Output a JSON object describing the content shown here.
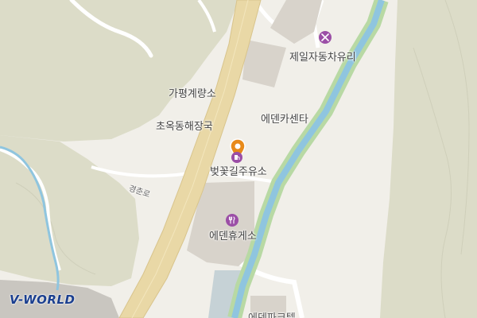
{
  "map": {
    "labels": {
      "weigh_station": "가평계량소",
      "restaurant": "초옥동해장국",
      "car_center": "에덴카센타",
      "glass_shop": "제일자동차유리",
      "gas_station": "벚꽃길주유소",
      "rest_area": "에덴휴게소",
      "road": "경춘로",
      "hotel": "에덴파크텔"
    },
    "icons": {
      "glass_shop": "tools-icon",
      "rest_area": "fork-knife-icon",
      "gas_station": "location-marker-icon"
    },
    "colors": {
      "background": "#f1efe9",
      "terrain": "#dcdcc8",
      "highway": "#e9d8a6",
      "river": "#8fc5df",
      "river_bank": "#b8d9a4",
      "building": "#d8d3cb",
      "poi_purple": "#9b4ea6",
      "marker_orange": "#e88a1a"
    }
  },
  "brand": {
    "logo_text": "V-WORLD"
  }
}
